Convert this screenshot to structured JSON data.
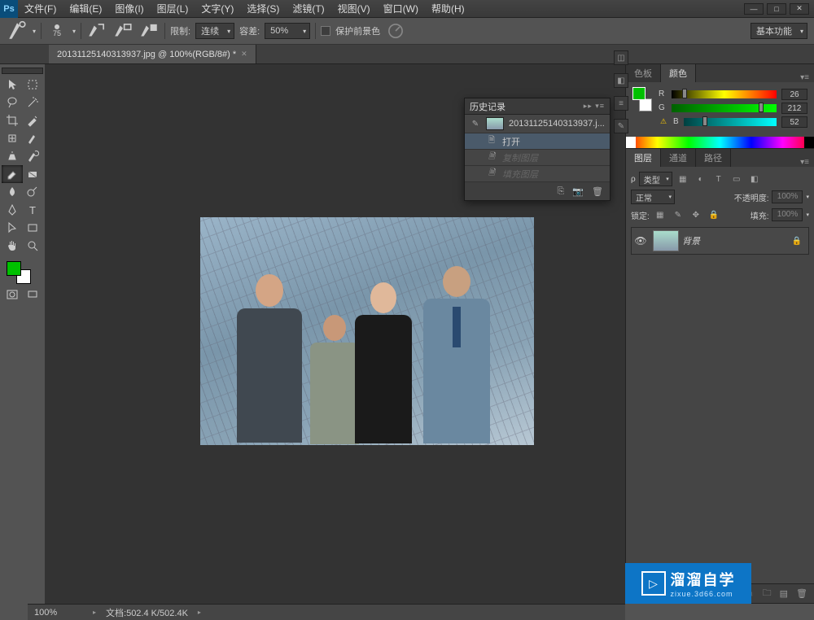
{
  "app": {
    "logo": "Ps"
  },
  "menubar": [
    "文件(F)",
    "编辑(E)",
    "图像(I)",
    "图层(L)",
    "文字(Y)",
    "选择(S)",
    "滤镜(T)",
    "视图(V)",
    "窗口(W)",
    "帮助(H)"
  ],
  "window_controls": {
    "min": "—",
    "max": "□",
    "close": "✕"
  },
  "optionsbar": {
    "brush_size": "75",
    "limit_label": "限制:",
    "limit_value": "连续",
    "tolerance_label": "容差:",
    "tolerance_value": "50%",
    "protect_fg": "保护前景色",
    "workspace": "基本功能"
  },
  "doc_tab": {
    "title": "20131125140313937.jpg @ 100%(RGB/8#) *"
  },
  "history": {
    "title": "历史记录",
    "source_name": "20131125140313937.j...",
    "items": [
      {
        "label": "打开",
        "active": true
      },
      {
        "label": "复制图层",
        "disabled": true
      },
      {
        "label": "填充图层",
        "disabled": true
      }
    ]
  },
  "color_panel": {
    "tabs": [
      "色板",
      "颜色"
    ],
    "r_label": "R",
    "r_value": "26",
    "g_label": "G",
    "g_value": "212",
    "b_label": "B",
    "b_value": "52"
  },
  "layers_panel": {
    "tabs": [
      "图层",
      "通道",
      "路径"
    ],
    "kind_label": "类型",
    "kind_icon": "ρ",
    "blend_mode": "正常",
    "opacity_label": "不透明度:",
    "opacity_value": "100%",
    "lock_label": "锁定:",
    "fill_label": "填充:",
    "fill_value": "100%",
    "layer_name": "背景"
  },
  "statusbar": {
    "zoom": "100%",
    "doc_info": "文档:502.4 K/502.4K"
  },
  "watermark": {
    "t1": "溜溜自学",
    "t2": "zixue.3d66.com"
  }
}
